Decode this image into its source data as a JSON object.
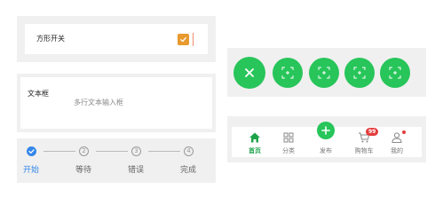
{
  "switch": {
    "label": "方形开关",
    "checked": true
  },
  "textarea": {
    "label": "文本框",
    "placeholder": "多行文本输入框"
  },
  "steps": {
    "items": [
      {
        "number": "",
        "label": "开始",
        "status": "done"
      },
      {
        "number": "2",
        "label": "等待",
        "status": "pending"
      },
      {
        "number": "3",
        "label": "错误",
        "status": "pending"
      },
      {
        "number": "4",
        "label": "完成",
        "status": "pending"
      }
    ],
    "active_color": "#3487e8"
  },
  "fab": {
    "main_icon": "close-icon",
    "actions": [
      "scan-icon",
      "scan-icon",
      "scan-icon",
      "scan-icon"
    ],
    "color": "#27c55a"
  },
  "tabbar": {
    "items": [
      {
        "label": "首页",
        "icon": "home-icon",
        "active": true
      },
      {
        "label": "分类",
        "icon": "grid-icon"
      },
      {
        "label": "发布",
        "icon": "plus-icon"
      },
      {
        "label": "购物车",
        "icon": "cart-icon",
        "badge": "99"
      },
      {
        "label": "我的",
        "icon": "user-icon",
        "dot": true
      }
    ],
    "active_color": "#1fa34a"
  }
}
